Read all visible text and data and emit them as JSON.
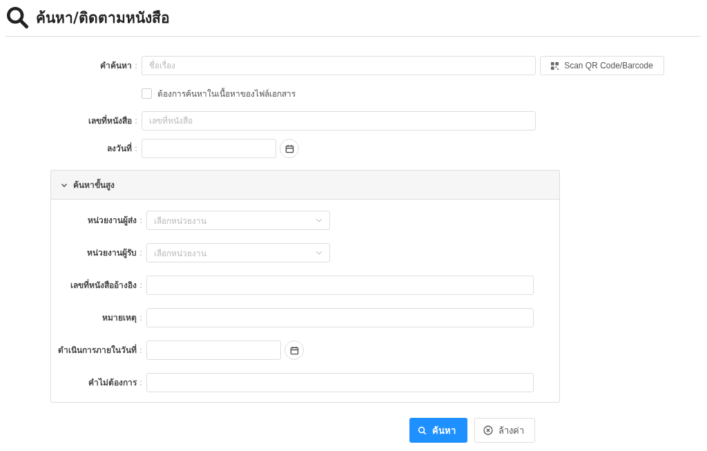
{
  "page": {
    "title": "ค้นหา/ติดตามหนังสือ"
  },
  "fields": [
    {
      "kind": "text",
      "label": "คำค้นหา",
      "colon": ":",
      "placeholder": "ชื่อเรื่อง",
      "button": "Scan QR Code/Barcode"
    },
    {
      "kind": "checkbox",
      "label": "ต้องการค้นหาในเนื้อหาของไฟล์เอกสาร",
      "checked": false
    },
    {
      "kind": "text",
      "label": "เลขที่หนังสือ",
      "colon": ":",
      "placeholder": "เลขที่หนังสือ"
    },
    {
      "kind": "date",
      "label": "ลงวันที่",
      "colon": ":"
    }
  ],
  "advanced": {
    "title": "ค้นหาขั้นสูง",
    "expanded": true,
    "fields": [
      {
        "kind": "select",
        "label": "หน่วยงานผู้ส่ง",
        "colon": ":",
        "placeholder": "เลือกหน่วยงาน"
      },
      {
        "kind": "select",
        "label": "หน่วยงานผู้รับ",
        "colon": ":",
        "placeholder": "เลือกหน่วยงาน"
      },
      {
        "kind": "text",
        "label": "เลขที่หนังสืออ้างอิง",
        "colon": ":"
      },
      {
        "kind": "text",
        "label": "หมายเหตุ",
        "colon": ":"
      },
      {
        "kind": "date",
        "label": "ดำเนินการภายในวันที่",
        "colon": ":"
      },
      {
        "kind": "text",
        "label": "คำไม่ต้องการ",
        "colon": ":"
      }
    ]
  },
  "buttons": [
    {
      "kind": "primary",
      "label": "ค้นหา"
    },
    {
      "kind": "reset",
      "label": "ล้างค่า"
    }
  ]
}
